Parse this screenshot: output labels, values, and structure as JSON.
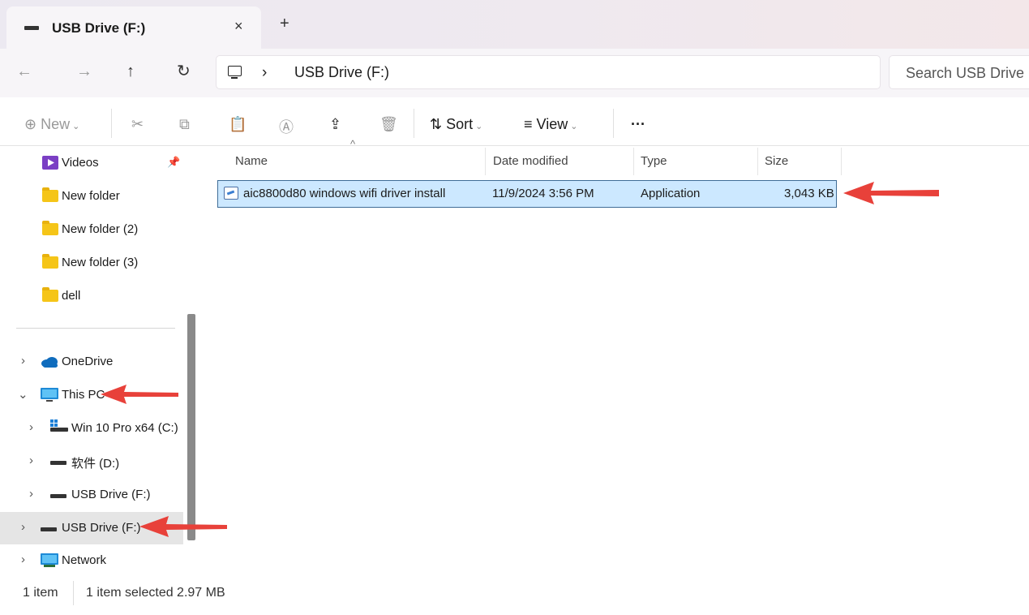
{
  "window": {
    "tab_title": "USB Drive (F:)",
    "tab_close": "×",
    "new_tab": "+"
  },
  "nav": {
    "back": "←",
    "forward": "→",
    "up": "↑",
    "refresh": "↻"
  },
  "address": {
    "separator": "›",
    "crumb": "USB Drive (F:)",
    "search_placeholder": "Search USB Drive (F:)"
  },
  "toolbar": {
    "new_icon": "⊕",
    "new_label": "New",
    "cut_icon": "✂",
    "copy_icon": "⧉",
    "paste_icon": "📋",
    "rename_icon": "Ⓐ",
    "share_icon": "⇪",
    "delete_icon": "🗑",
    "sort_icon": "⇅",
    "sort_label": "Sort",
    "view_icon": "≡",
    "view_label": "View",
    "more_label": "···",
    "chevron": "⌄"
  },
  "sidebar": {
    "pin_icon": "📌",
    "quick_access": [
      {
        "label": "Videos"
      },
      {
        "label": "New folder"
      },
      {
        "label": "New folder (2)"
      },
      {
        "label": "New folder (3)"
      },
      {
        "label": "dell"
      }
    ],
    "tree": [
      {
        "label": "OneDrive",
        "expander": "›"
      },
      {
        "label": "This PC",
        "expander": "⌄"
      },
      {
        "label": "Win 10 Pro x64 (C:)",
        "expander": "›"
      },
      {
        "label": "软件 (D:)",
        "expander": "›"
      },
      {
        "label": "USB Drive (F:)",
        "expander": "›"
      },
      {
        "label": "USB Drive (F:)",
        "expander": "›"
      },
      {
        "label": "Network",
        "expander": "›"
      }
    ]
  },
  "filelist": {
    "columns": [
      "Name",
      "Date modified",
      "Type",
      "Size"
    ],
    "sort_caret": "^",
    "rows": [
      {
        "name": "aic8800d80 windows wifi driver install",
        "date": "11/9/2024 3:56 PM",
        "type": "Application",
        "size": "3,043 KB"
      }
    ]
  },
  "status": {
    "count": "1 item",
    "selection": "1 item selected  2.97 MB"
  },
  "colors": {
    "selection": "#cce8ff",
    "annotation_arrow": "#e8413a"
  }
}
